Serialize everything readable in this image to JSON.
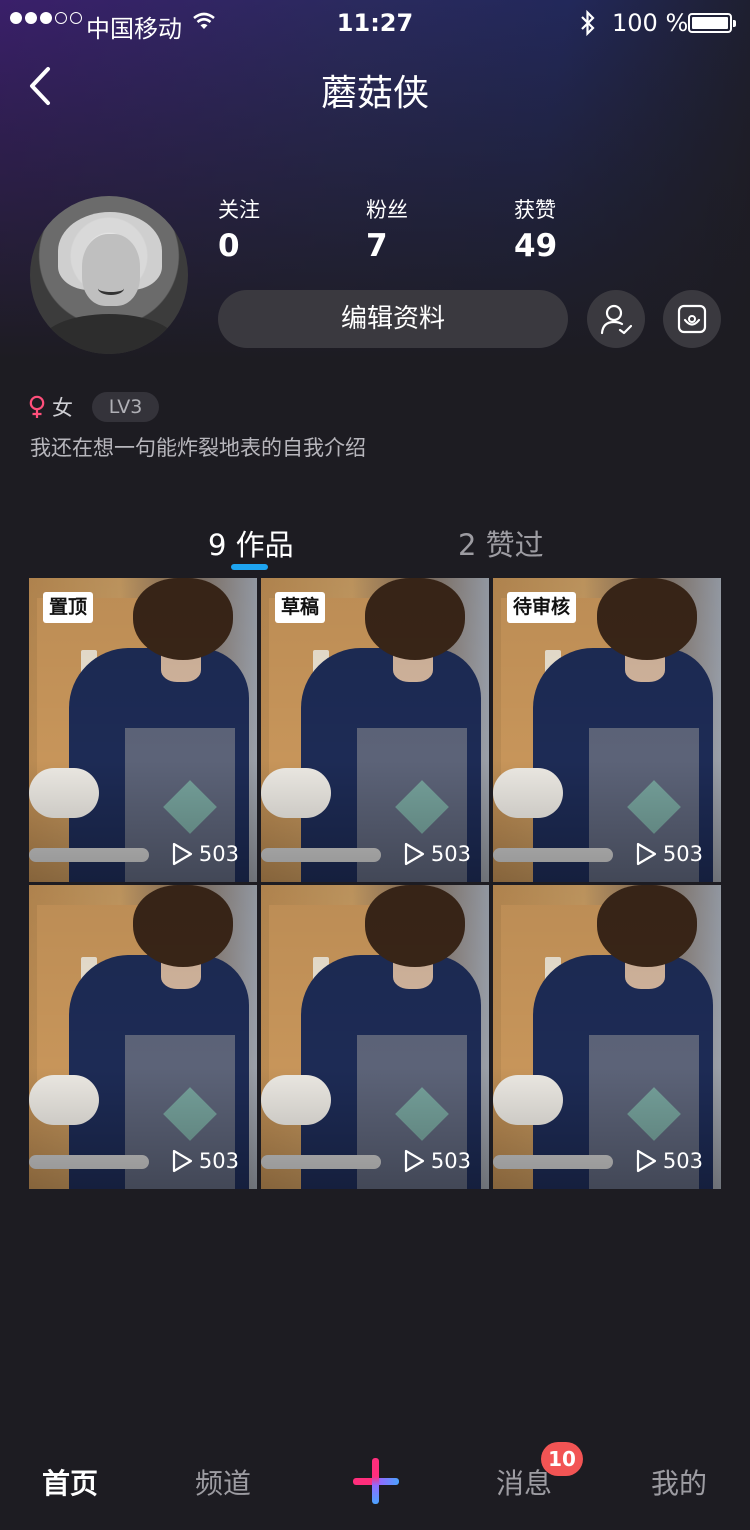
{
  "status_bar": {
    "carrier": "中国移动",
    "time": "11:27",
    "battery": "100 %"
  },
  "header": {
    "title": "蘑菇侠"
  },
  "profile": {
    "stats": [
      {
        "label": "关注",
        "value": "0"
      },
      {
        "label": "粉丝",
        "value": "7"
      },
      {
        "label": "获赞",
        "value": "49"
      }
    ],
    "edit_label": "编辑资料",
    "gender": "女",
    "level": "LV3",
    "bio": "我还在想一句能炸裂地表的自我介绍"
  },
  "tabs": [
    {
      "label": "9 作品",
      "active": true
    },
    {
      "label": "2 赞过",
      "active": false
    }
  ],
  "works": [
    {
      "tag": "置顶",
      "plays": "503"
    },
    {
      "tag": "草稿",
      "plays": "503"
    },
    {
      "tag": "待审核",
      "plays": "503"
    },
    {
      "tag": "",
      "plays": "503"
    },
    {
      "tag": "",
      "plays": "503"
    },
    {
      "tag": "",
      "plays": "503"
    }
  ],
  "tabbar": {
    "items": [
      {
        "label": "首页",
        "active": true
      },
      {
        "label": "频道",
        "active": false
      },
      {
        "label": "消息",
        "active": false
      },
      {
        "label": "我的",
        "active": false
      }
    ],
    "messages_badge": "10"
  },
  "colors": {
    "background": "#1d1c22",
    "accent": "#1ea4f0",
    "badge": "#f25454",
    "female_icon": "#ff4f7b"
  }
}
